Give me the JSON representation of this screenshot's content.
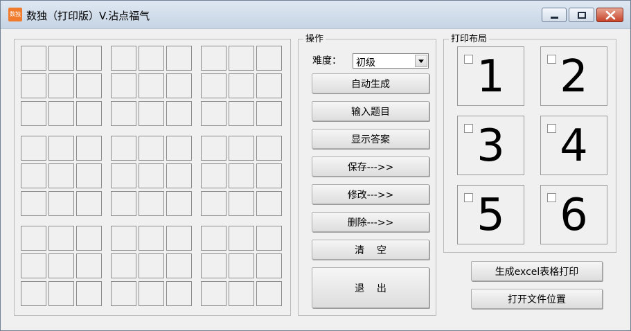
{
  "window": {
    "app_icon_text": "数独",
    "title": "数独（打印版）V.沾点福气",
    "controls": [
      "minimize",
      "maximize",
      "close"
    ]
  },
  "operations": {
    "legend": "操作",
    "difficulty_label": "难度：",
    "difficulty_selected": "初级",
    "buttons": {
      "auto_generate": "自动生成",
      "input_puzzle": "输入题目",
      "show_answer": "显示答案",
      "save": "保存--->>",
      "modify": "修改--->>",
      "delete": "删除--->>",
      "clear": "清    空",
      "exit": "退    出"
    }
  },
  "print_layout": {
    "legend": "打印布局",
    "slots": [
      {
        "number": "1",
        "checked": false
      },
      {
        "number": "2",
        "checked": false
      },
      {
        "number": "3",
        "checked": false
      },
      {
        "number": "4",
        "checked": false
      },
      {
        "number": "5",
        "checked": false
      },
      {
        "number": "6",
        "checked": false
      }
    ]
  },
  "actions": {
    "generate_excel": "生成excel表格打印",
    "open_file_location": "打开文件位置"
  },
  "grid": {
    "size": 9,
    "cells": [
      [
        "",
        "",
        "",
        "",
        "",
        "",
        "",
        "",
        ""
      ],
      [
        "",
        "",
        "",
        "",
        "",
        "",
        "",
        "",
        ""
      ],
      [
        "",
        "",
        "",
        "",
        "",
        "",
        "",
        "",
        ""
      ],
      [
        "",
        "",
        "",
        "",
        "",
        "",
        "",
        "",
        ""
      ],
      [
        "",
        "",
        "",
        "",
        "",
        "",
        "",
        "",
        ""
      ],
      [
        "",
        "",
        "",
        "",
        "",
        "",
        "",
        "",
        ""
      ],
      [
        "",
        "",
        "",
        "",
        "",
        "",
        "",
        "",
        ""
      ],
      [
        "",
        "",
        "",
        "",
        "",
        "",
        "",
        "",
        ""
      ],
      [
        "",
        "",
        "",
        "",
        "",
        "",
        "",
        "",
        ""
      ]
    ]
  }
}
